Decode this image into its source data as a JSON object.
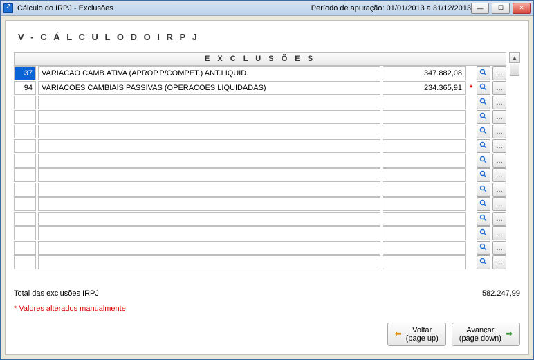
{
  "titlebar": {
    "title": "Cálculo do IRPJ - Exclusões",
    "period_label": "Período de apuração: 01/01/2013 a 31/12/2013"
  },
  "section_title": "V - C Á L C U L O   D O   I R P J",
  "grid": {
    "header": "E X C L U S Õ E S",
    "rows": [
      {
        "code": "37",
        "desc": "VARIACAO CAMB.ATIVA (APROP.P/COMPET.) ANT.LIQUID.",
        "amount": "347.882,08",
        "flag": "",
        "selected": true
      },
      {
        "code": "94",
        "desc": "VARIACOES CAMBIAIS PASSIVAS (OPERACOES LIQUIDADAS)",
        "amount": "234.365,91",
        "flag": "*",
        "selected": false
      },
      {
        "code": "",
        "desc": "",
        "amount": "",
        "flag": "",
        "selected": false
      },
      {
        "code": "",
        "desc": "",
        "amount": "",
        "flag": "",
        "selected": false
      },
      {
        "code": "",
        "desc": "",
        "amount": "",
        "flag": "",
        "selected": false
      },
      {
        "code": "",
        "desc": "",
        "amount": "",
        "flag": "",
        "selected": false
      },
      {
        "code": "",
        "desc": "",
        "amount": "",
        "flag": "",
        "selected": false
      },
      {
        "code": "",
        "desc": "",
        "amount": "",
        "flag": "",
        "selected": false
      },
      {
        "code": "",
        "desc": "",
        "amount": "",
        "flag": "",
        "selected": false
      },
      {
        "code": "",
        "desc": "",
        "amount": "",
        "flag": "",
        "selected": false
      },
      {
        "code": "",
        "desc": "",
        "amount": "",
        "flag": "",
        "selected": false
      },
      {
        "code": "",
        "desc": "",
        "amount": "",
        "flag": "",
        "selected": false
      },
      {
        "code": "",
        "desc": "",
        "amount": "",
        "flag": "",
        "selected": false
      },
      {
        "code": "",
        "desc": "",
        "amount": "",
        "flag": "",
        "selected": false
      }
    ]
  },
  "total": {
    "label": "Total das exclusões IRPJ",
    "value": "582.247,99"
  },
  "manual_note": "* Valores alterados manualmente",
  "footer": {
    "back_label": "Voltar\n(page up)",
    "next_label": "Avançar\n(page down)"
  }
}
